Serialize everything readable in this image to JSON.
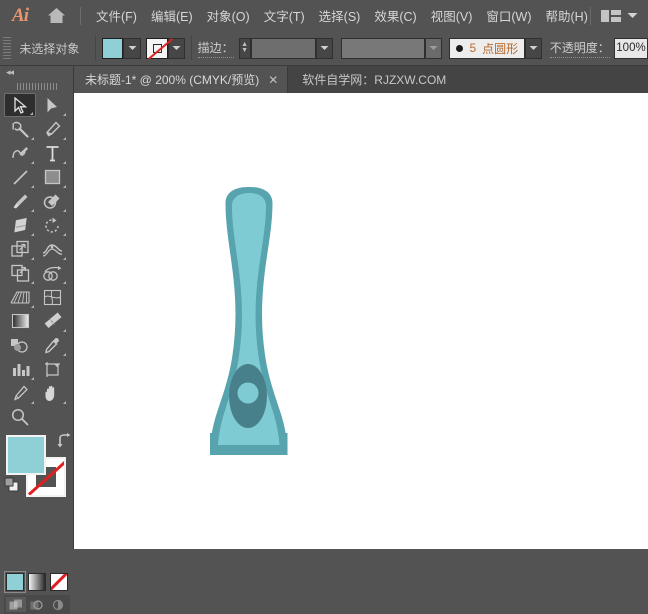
{
  "app": {
    "name": "Adobe Illustrator",
    "logo_text": "Ai",
    "home_icon": "home-icon",
    "workspace_icon": "workspace-switcher-icon",
    "workspace_chevron": "chevron-down-icon"
  },
  "menubar": {
    "items": [
      {
        "label": "文件(F)",
        "name": "menu-file"
      },
      {
        "label": "编辑(E)",
        "name": "menu-edit"
      },
      {
        "label": "对象(O)",
        "name": "menu-object"
      },
      {
        "label": "文字(T)",
        "name": "menu-type"
      },
      {
        "label": "选择(S)",
        "name": "menu-select"
      },
      {
        "label": "效果(C)",
        "name": "menu-effect"
      },
      {
        "label": "视图(V)",
        "name": "menu-view"
      },
      {
        "label": "窗口(W)",
        "name": "menu-window"
      },
      {
        "label": "帮助(H)",
        "name": "menu-help"
      }
    ]
  },
  "controlbar": {
    "selection_status": "未选择对象",
    "fill_color": "#8fd0d6",
    "fill_label": "fill-swatch",
    "stroke_label": "stroke-swatch-none",
    "stroke_weight_label": "描边：",
    "stroke_weight_value": "",
    "stroke_profile_value": "",
    "brush_dot": "●",
    "brush_number": "5",
    "brush_name": "点圆形",
    "opacity_label": "不透明度：",
    "opacity_value": "100%"
  },
  "tabbar": {
    "document_title": "未标题-1* @ 200% (CMYK/预览)",
    "close_glyph": "✕",
    "watermark": "软件自学网：RJZXW.COM"
  },
  "toolbar": {
    "collapse_glyph": "◂◂",
    "tools": [
      {
        "name": "selection-tool",
        "label": "选择工具",
        "active": true,
        "menu": true
      },
      {
        "name": "direct-selection-tool",
        "label": "直接选择工具",
        "active": false,
        "menu": true
      },
      {
        "name": "magic-wand-tool",
        "label": "魔棒工具",
        "active": false,
        "menu": true
      },
      {
        "name": "pen-tool",
        "label": "钢笔工具",
        "active": false,
        "menu": true
      },
      {
        "name": "curvature-tool",
        "label": "曲率工具",
        "active": false,
        "menu": true
      },
      {
        "name": "type-tool",
        "label": "文字工具",
        "active": false,
        "menu": true
      },
      {
        "name": "line-segment-tool",
        "label": "直线段工具",
        "active": false,
        "menu": true
      },
      {
        "name": "rectangle-tool",
        "label": "矩形工具",
        "active": false,
        "menu": true
      },
      {
        "name": "paintbrush-tool",
        "label": "画笔工具",
        "active": false,
        "menu": true
      },
      {
        "name": "shaper-tool",
        "label": "Shaper 工具",
        "active": false,
        "menu": true
      },
      {
        "name": "eraser-tool",
        "label": "橡皮擦工具",
        "active": false,
        "menu": true
      },
      {
        "name": "rotate-tool",
        "label": "旋转工具",
        "active": false,
        "menu": true
      },
      {
        "name": "scale-tool",
        "label": "缩放工具",
        "active": false,
        "menu": true
      },
      {
        "name": "width-tool",
        "label": "宽度工具",
        "active": false,
        "menu": true
      },
      {
        "name": "free-transform-tool",
        "label": "自由变换工具",
        "active": false,
        "menu": true
      },
      {
        "name": "shape-builder-tool",
        "label": "形状生成器工具",
        "active": false,
        "menu": true
      },
      {
        "name": "perspective-grid-tool",
        "label": "透视网格工具",
        "active": false,
        "menu": true
      },
      {
        "name": "mesh-tool",
        "label": "网格工具",
        "active": false,
        "menu": false
      },
      {
        "name": "gradient-tool",
        "label": "渐变工具",
        "active": false,
        "menu": false
      },
      {
        "name": "measure-tool",
        "label": "度量工具",
        "active": false,
        "menu": true
      },
      {
        "name": "blend-tool",
        "label": "混合工具",
        "active": false,
        "menu": false
      },
      {
        "name": "eyedropper-tool",
        "label": "吸管工具",
        "active": false,
        "menu": true
      },
      {
        "name": "column-graph-tool",
        "label": "柱形图工具",
        "active": false,
        "menu": true
      },
      {
        "name": "artboard-tool",
        "label": "画板工具",
        "active": false,
        "menu": false
      },
      {
        "name": "slice-tool",
        "label": "切片工具",
        "active": false,
        "menu": true
      },
      {
        "name": "hand-tool",
        "label": "抓手工具",
        "active": false,
        "menu": true
      },
      {
        "name": "zoom-tool",
        "label": "缩放工具",
        "active": false,
        "menu": false
      }
    ],
    "fill_color": "#8fd0d6",
    "stroke_color": "none",
    "swap_icon": "swap-fill-stroke-icon",
    "default_icon": "default-fill-stroke-icon",
    "modes": [
      {
        "name": "color-mode-button",
        "selected": true
      },
      {
        "name": "gradient-mode-button",
        "selected": false
      },
      {
        "name": "none-mode-button",
        "selected": false
      }
    ],
    "draw_modes": [
      {
        "name": "draw-normal-button",
        "selected": true
      },
      {
        "name": "draw-behind-button",
        "selected": false
      },
      {
        "name": "draw-inside-button",
        "selected": false
      }
    ]
  },
  "artwork": {
    "name": "spatula-shape",
    "outer_color": "#57a3ae",
    "inner_color": "#7fcbd4",
    "detail_color": "#47808b",
    "hole_color": "#7fcbd4",
    "zoom": "200%"
  }
}
